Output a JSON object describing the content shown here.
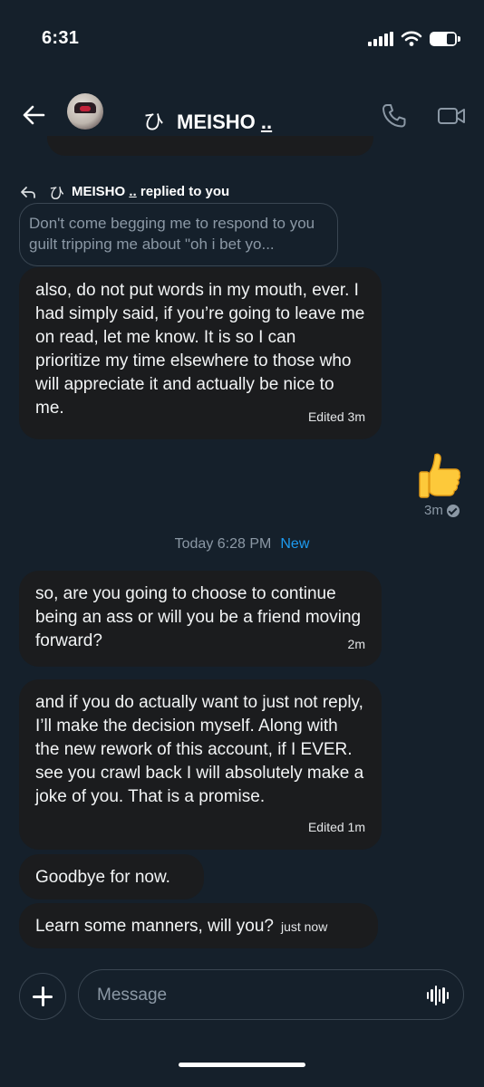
{
  "status_bar": {
    "time": "6:31"
  },
  "header": {
    "glyph": "ひ",
    "name": "MEISHO",
    "name_suffix": ".."
  },
  "reply_context": {
    "glyph": "ひ",
    "name": "MEISHO",
    "name_suffix": "..",
    "suffix_text": "replied to you",
    "quoted_text": "Don't come begging me to respond to you guilt tripping me about \"oh i bet yo..."
  },
  "messages": [
    {
      "text": "also, do not put words in my mouth, ever. I had simply said, if you’re going to leave me on read, let me know. It is so I can prioritize my time elsewhere to those who will appreciate it and actually be nice to me.",
      "meta": "Edited 3m"
    },
    {
      "text": "so, are you going to choose to continue being an ass or will you be a friend moving forward?",
      "meta": "2m"
    },
    {
      "text": "and if you do actually want to just not reply, I’ll make the decision myself. Along with the new rework of this account, if I EVER. see you crawl back I will absolutely make a joke of you. That is a promise.",
      "meta": "Edited 1m"
    },
    {
      "text": "Goodbye for now.",
      "meta": ""
    },
    {
      "text": "Learn some manners, will you?",
      "meta": "just now"
    }
  ],
  "sent_message": {
    "emoji_icon": "thumbs-up-icon",
    "meta": "3m"
  },
  "divider": {
    "label": "Today 6:28 PM",
    "badge": "New"
  },
  "composer": {
    "placeholder": "Message"
  },
  "colors": {
    "background": "#15202b",
    "bubble": "#1b1c1e",
    "accent": "#1d9bf0",
    "muted": "#8b98a5"
  }
}
